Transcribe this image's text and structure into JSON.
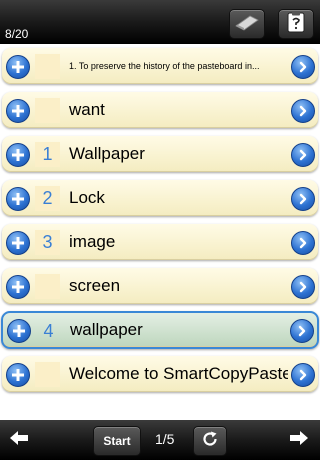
{
  "header": {
    "counter": "8/20",
    "eraser_icon": "eraser-icon",
    "clipboard_icon": "clipboard-icon"
  },
  "rows": [
    {
      "number": "",
      "text": "1. To preserve the history of the pasteboard in...",
      "selected": false
    },
    {
      "number": "",
      "text": "want",
      "selected": false
    },
    {
      "number": "1",
      "text": "Wallpaper",
      "selected": false
    },
    {
      "number": "2",
      "text": "Lock",
      "selected": false
    },
    {
      "number": "3",
      "text": "image",
      "selected": false
    },
    {
      "number": "",
      "text": "screen",
      "selected": false
    },
    {
      "number": "4",
      "text": "wallpaper",
      "selected": true
    },
    {
      "number": "",
      "text": "Welcome to SmartCopyPaste.",
      "selected": false
    }
  ],
  "footer": {
    "start_label": "Start",
    "page": "1/5",
    "left_icon": "arrow-left-icon",
    "right_icon": "arrow-right-icon",
    "refresh_icon": "refresh-icon"
  },
  "colors": {
    "row_bg": "#f7f0cc",
    "selected_row_bg": "#cfe2cf",
    "selected_border": "#3a88d6",
    "accent_blue": "#2d72d2",
    "bar_bg": "#1a1a1a"
  }
}
